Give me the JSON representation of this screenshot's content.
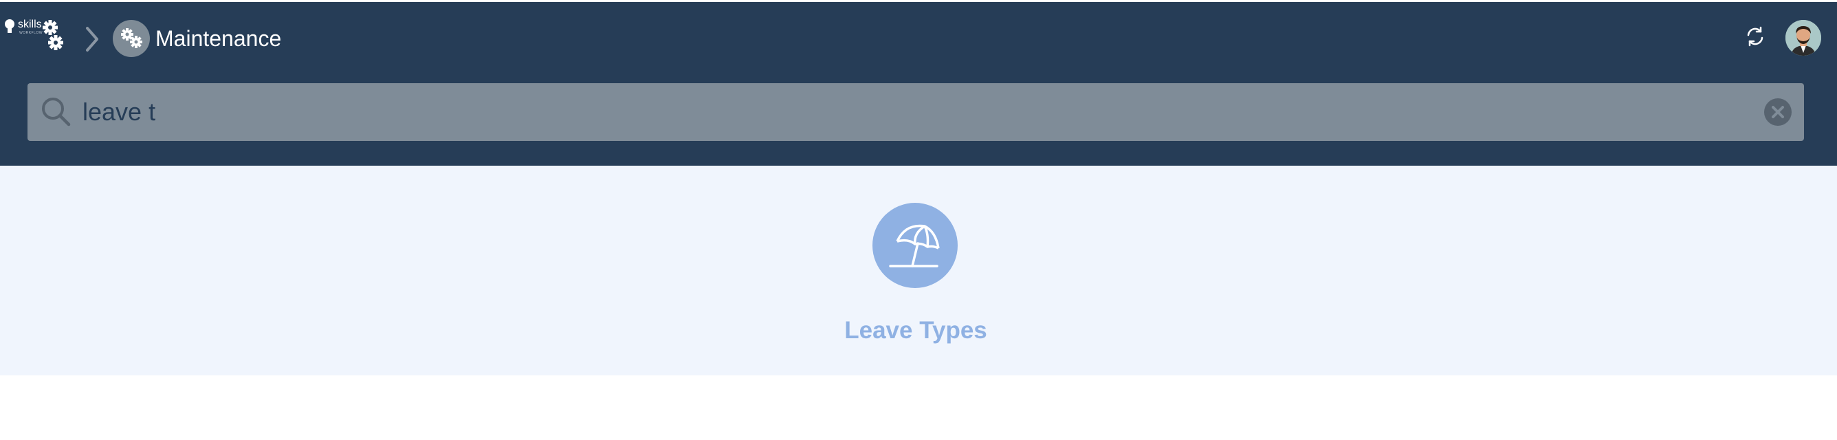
{
  "header": {
    "logo_text": "skills",
    "logo_subtext": "WORKFLOW",
    "breadcrumb_title": "Maintenance"
  },
  "search": {
    "value": "leave t"
  },
  "results": [
    {
      "label": "Leave Types",
      "icon": "beach-umbrella-icon"
    }
  ],
  "colors": {
    "header_bg": "#263d57",
    "search_bg": "#7f8c98",
    "content_bg": "#f0f5fd",
    "accent": "#8fb1e3"
  }
}
